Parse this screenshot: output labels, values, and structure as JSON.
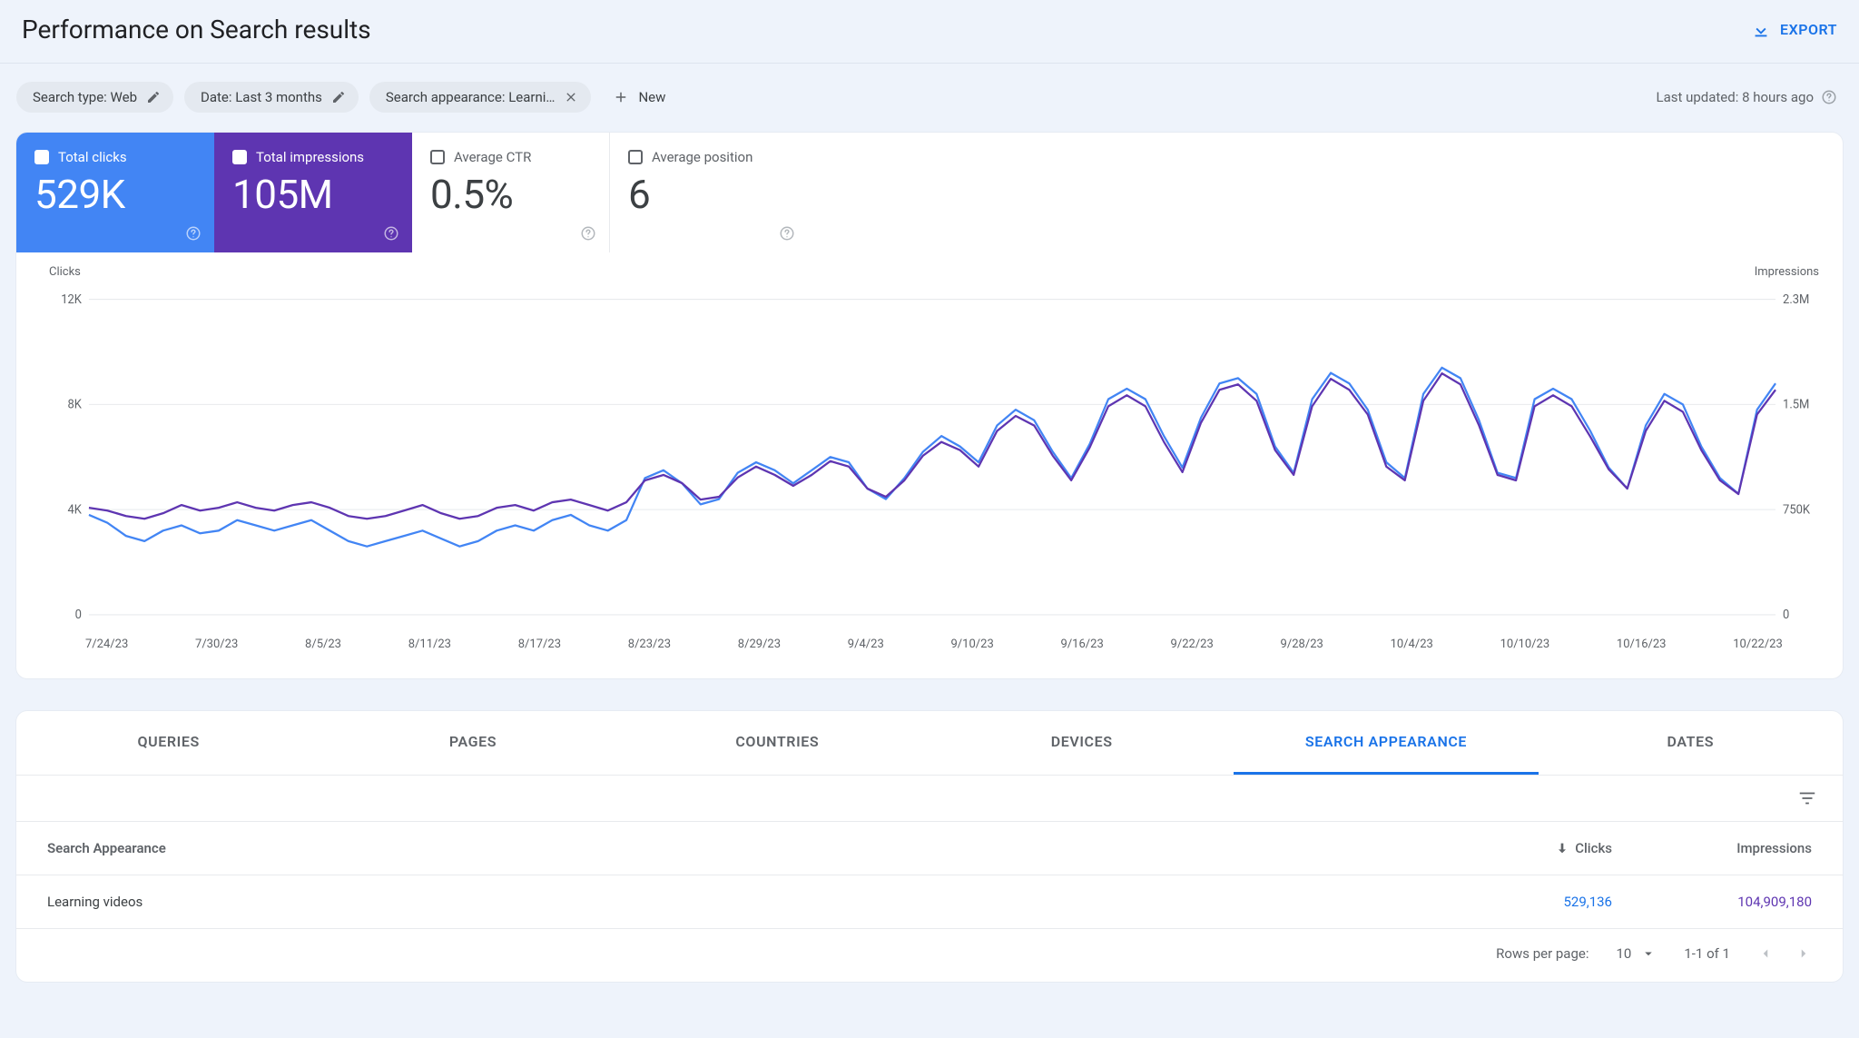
{
  "header": {
    "title": "Performance on Search results",
    "export_label": "EXPORT"
  },
  "filters": {
    "chips": [
      {
        "label": "Search type: Web",
        "action": "edit"
      },
      {
        "label": "Date: Last 3 months",
        "action": "edit"
      },
      {
        "label": "Search appearance: Learni…",
        "action": "close"
      }
    ],
    "new_label": "New",
    "last_updated": "Last updated: 8 hours ago"
  },
  "metrics": [
    {
      "label": "Total clicks",
      "value": "529K",
      "checked": true,
      "variant": "blue"
    },
    {
      "label": "Total impressions",
      "value": "105M",
      "checked": true,
      "variant": "purple"
    },
    {
      "label": "Average CTR",
      "value": "0.5%",
      "checked": false,
      "variant": "plain"
    },
    {
      "label": "Average position",
      "value": "6",
      "checked": false,
      "variant": "plain"
    }
  ],
  "chart_data": {
    "type": "line",
    "xlabel": "",
    "left_axis_title": "Clicks",
    "right_axis_title": "Impressions",
    "left_ylim": [
      0,
      12000
    ],
    "right_ylim": [
      0,
      2300000
    ],
    "left_ticks": [
      "12K",
      "8K",
      "4K",
      "0"
    ],
    "right_ticks": [
      "2.3M",
      "1.5M",
      "750K",
      "0"
    ],
    "x_ticks": [
      "7/24/23",
      "7/30/23",
      "8/5/23",
      "8/11/23",
      "8/17/23",
      "8/23/23",
      "8/29/23",
      "9/4/23",
      "9/10/23",
      "9/16/23",
      "9/22/23",
      "9/28/23",
      "10/4/23",
      "10/10/23",
      "10/16/23",
      "10/22/23"
    ],
    "series": [
      {
        "name": "Clicks",
        "axis": "left",
        "color": "#4285f4",
        "values": [
          3800,
          3500,
          3000,
          2800,
          3200,
          3400,
          3100,
          3200,
          3600,
          3400,
          3200,
          3400,
          3600,
          3200,
          2800,
          2600,
          2800,
          3000,
          3200,
          2900,
          2600,
          2800,
          3200,
          3400,
          3200,
          3600,
          3800,
          3400,
          3200,
          3600,
          5200,
          5500,
          5000,
          4200,
          4400,
          5400,
          5800,
          5500,
          5000,
          5500,
          6000,
          5800,
          4800,
          4400,
          5200,
          6200,
          6800,
          6400,
          5800,
          7200,
          7800,
          7400,
          6200,
          5200,
          6500,
          8200,
          8600,
          8200,
          6800,
          5600,
          7500,
          8800,
          9000,
          8400,
          6400,
          5400,
          8200,
          9200,
          8800,
          7800,
          5800,
          5200,
          8400,
          9400,
          9000,
          7400,
          5400,
          5200,
          8200,
          8600,
          8200,
          7000,
          5600,
          4800,
          7200,
          8400,
          8000,
          6400,
          5200,
          4600,
          7800,
          8800
        ]
      },
      {
        "name": "Impressions",
        "axis": "right",
        "color": "#5e35b1",
        "values": [
          780000,
          760000,
          720000,
          700000,
          740000,
          800000,
          760000,
          780000,
          820000,
          780000,
          760000,
          800000,
          820000,
          780000,
          720000,
          700000,
          720000,
          760000,
          800000,
          740000,
          700000,
          720000,
          780000,
          800000,
          760000,
          820000,
          840000,
          800000,
          760000,
          820000,
          980000,
          1020000,
          960000,
          840000,
          860000,
          1000000,
          1080000,
          1020000,
          940000,
          1020000,
          1120000,
          1080000,
          920000,
          860000,
          980000,
          1160000,
          1260000,
          1200000,
          1080000,
          1340000,
          1450000,
          1380000,
          1160000,
          980000,
          1220000,
          1520000,
          1600000,
          1520000,
          1260000,
          1040000,
          1400000,
          1640000,
          1680000,
          1560000,
          1200000,
          1020000,
          1520000,
          1720000,
          1640000,
          1460000,
          1080000,
          980000,
          1560000,
          1760000,
          1680000,
          1380000,
          1020000,
          980000,
          1520000,
          1600000,
          1520000,
          1300000,
          1060000,
          920000,
          1340000,
          1560000,
          1480000,
          1200000,
          980000,
          880000,
          1460000,
          1640000
        ]
      }
    ]
  },
  "tabs": [
    "QUERIES",
    "PAGES",
    "COUNTRIES",
    "DEVICES",
    "SEARCH APPEARANCE",
    "DATES"
  ],
  "active_tab": 4,
  "table": {
    "columns": {
      "name": "Search Appearance",
      "clicks": "Clicks",
      "impressions": "Impressions"
    },
    "rows": [
      {
        "name": "Learning videos",
        "clicks": "529,136",
        "impressions": "104,909,180"
      }
    ]
  },
  "pager": {
    "rows_label": "Rows per page:",
    "rows_value": "10",
    "range": "1-1 of 1"
  }
}
